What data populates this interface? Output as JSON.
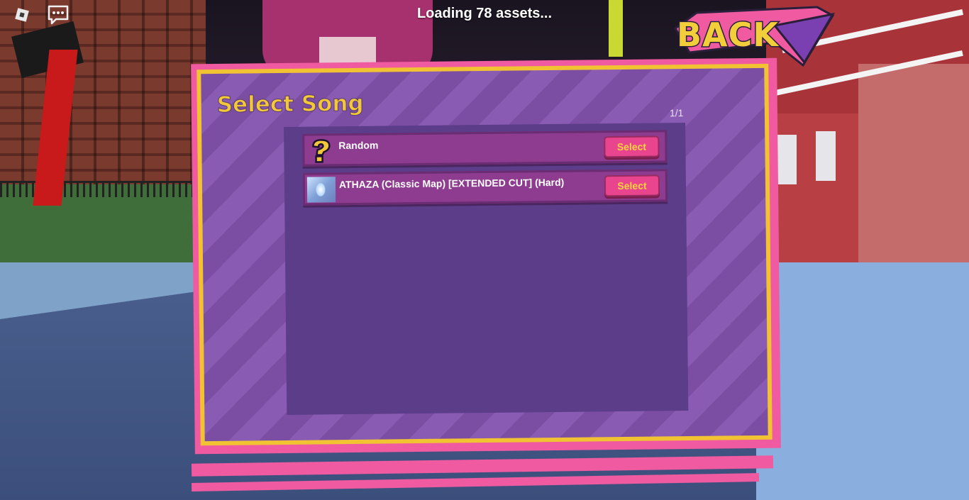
{
  "hud": {
    "loading_text": "Loading 78 assets...",
    "roblox_menu_icon": "roblox-logo-icon",
    "chat_icon": "chat-bubble-icon"
  },
  "back_button": {
    "label": "BACK"
  },
  "panel": {
    "title": "Select Song",
    "page_indicator": "1/1",
    "songs": [
      {
        "title": "Random",
        "icon": "question-mark-icon",
        "select_label": "Select"
      },
      {
        "title": "ATHAZA (Classic Map) [EXTENDED CUT] (Hard)",
        "icon": "song-thumbnail",
        "select_label": "Select"
      }
    ]
  },
  "colors": {
    "panel_pink": "#ef5aa0",
    "panel_gold": "#f1c232",
    "panel_purple": "#7c4ea3",
    "list_bg": "#5b3d89",
    "row_bg": "#8e3c8f",
    "select_button": "#e9458e",
    "select_text": "#f6d23c",
    "title_text": "#f2c83a"
  }
}
